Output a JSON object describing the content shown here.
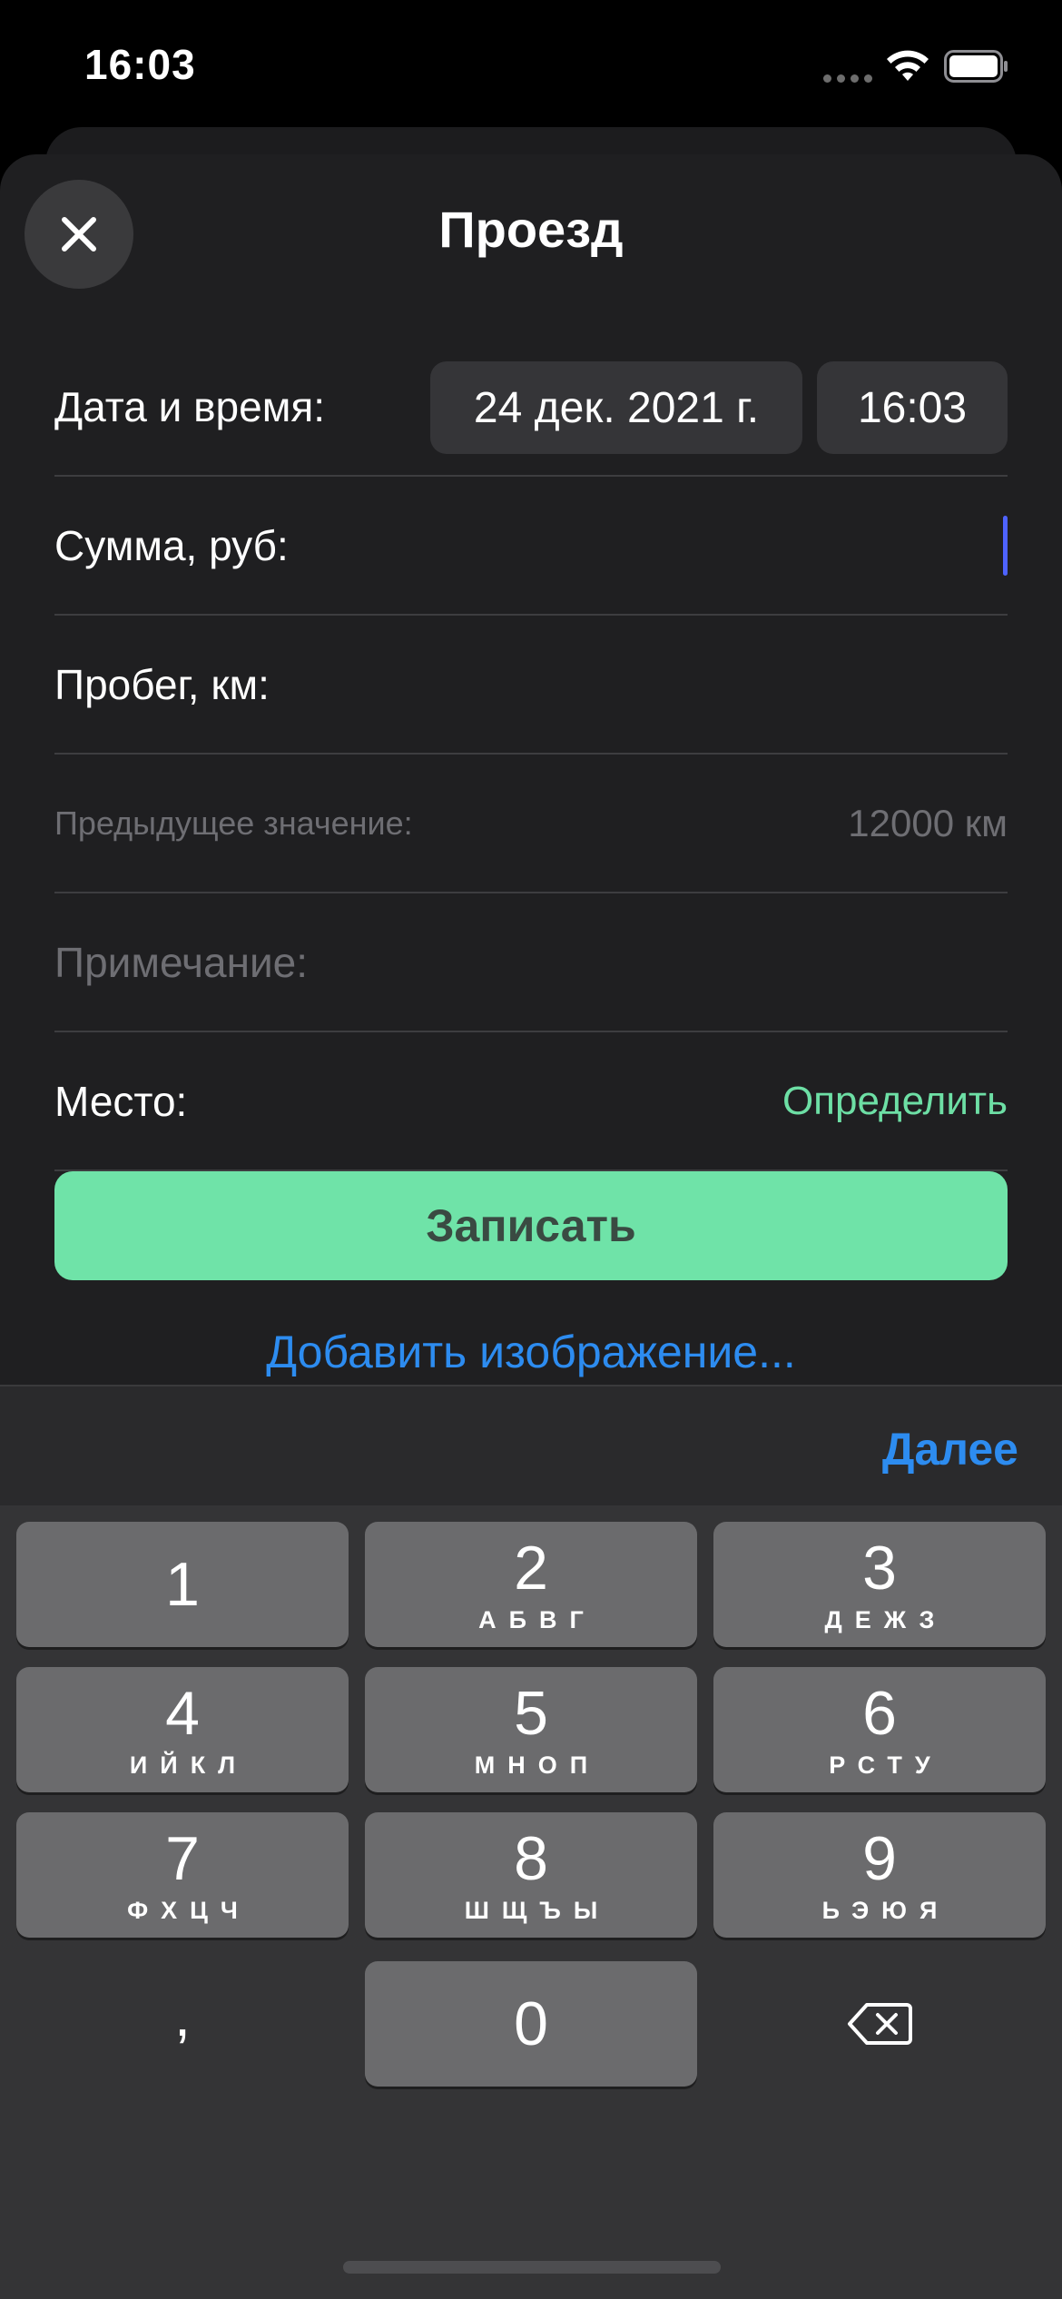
{
  "status_bar": {
    "time": "16:03"
  },
  "header": {
    "title": "Проезд",
    "close_icon": "close-icon"
  },
  "form": {
    "datetime": {
      "label": "Дата и время:",
      "date": "24 дек. 2021 г.",
      "time": "16:03"
    },
    "amount": {
      "label": "Сумма, руб:",
      "value": ""
    },
    "mileage": {
      "label": "Пробег, км:",
      "value": ""
    },
    "previous": {
      "label": "Предыдущее значение:",
      "value": "12000 км"
    },
    "note": {
      "placeholder": "Примечание:"
    },
    "place": {
      "label": "Место:",
      "action": "Определить"
    },
    "submit_label": "Записать",
    "add_image_label": "Добавить изображение..."
  },
  "keyboard": {
    "accessory_next": "Далее",
    "keys": [
      {
        "digit": "1",
        "letters": ""
      },
      {
        "digit": "2",
        "letters": "АБВГ"
      },
      {
        "digit": "3",
        "letters": "ДЕЖЗ"
      },
      {
        "digit": "4",
        "letters": "ИЙКЛ"
      },
      {
        "digit": "5",
        "letters": "МНОП"
      },
      {
        "digit": "6",
        "letters": "РСТУ"
      },
      {
        "digit": "7",
        "letters": "ФХЦЧ"
      },
      {
        "digit": "8",
        "letters": "ШЩЪЫ"
      },
      {
        "digit": "9",
        "letters": "ЬЭЮЯ"
      },
      {
        "digit": "0",
        "letters": ""
      }
    ],
    "comma": ",",
    "backspace_icon": "backspace-icon"
  },
  "colors": {
    "accent_green": "#6fe3a8",
    "link_blue": "#2d8cf0",
    "caret_blue": "#4e63ff",
    "sheet_background": "#1f1f21",
    "key_background": "#6b6b6d"
  }
}
